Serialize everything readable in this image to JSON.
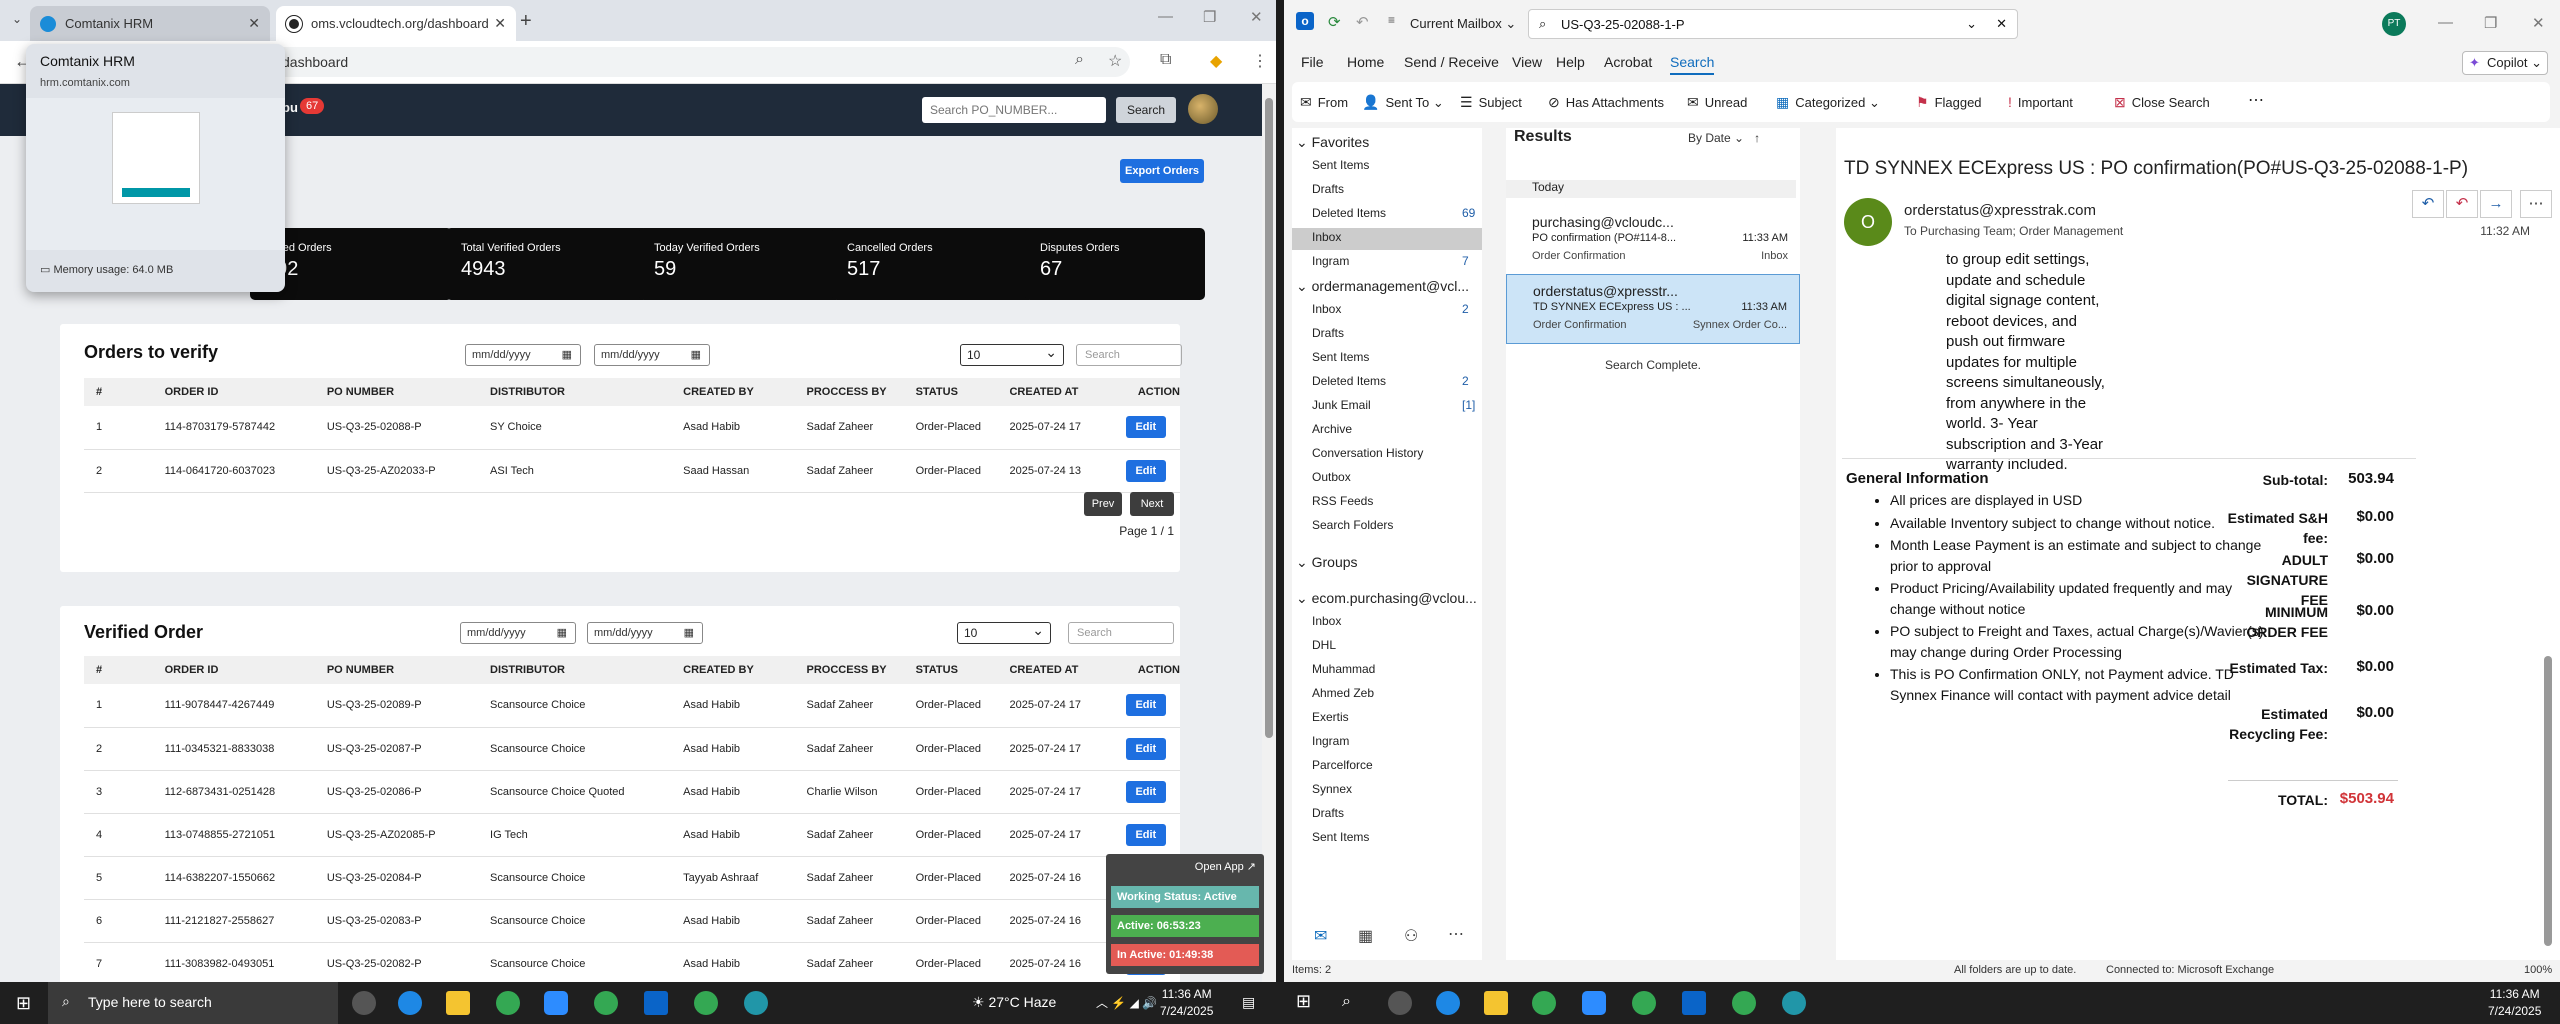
{
  "chrome": {
    "tabs": [
      {
        "title": "Comtanix HRM"
      },
      {
        "title": "oms.vcloudtech.org/dashboard"
      }
    ],
    "url_fragment": "dashboard",
    "hover_card": {
      "title": "Comtanix HRM",
      "host": "hrm.comtanix.com",
      "memory": "Memory usage: 64.0 MB"
    }
  },
  "app": {
    "nav": {
      "brand_fragment": "pu",
      "badge": "67",
      "search_placeholder": "Search PO_NUMBER...",
      "search_button": "Search"
    },
    "export_button": "Export Orders",
    "stats": [
      {
        "label": "pleted Orders",
        "value": "592"
      },
      {
        "label": "Total Verified Orders",
        "value": "4943"
      },
      {
        "label": "Today Verified Orders",
        "value": "59"
      },
      {
        "label": "Cancelled Orders",
        "value": "517"
      },
      {
        "label": "Disputes Orders",
        "value": "67"
      }
    ],
    "date_placeholder": "mm/dd/yyyy",
    "page_size": "10",
    "table_search_placeholder": "Search",
    "columns": [
      "#",
      "ORDER ID",
      "PO NUMBER",
      "DISTRIBUTOR",
      "CREATED BY",
      "PROCCESS BY",
      "STATUS",
      "CREATED AT",
      "ACTION"
    ],
    "orders_to_verify": {
      "title": "Orders to verify",
      "rows": [
        [
          "1",
          "114-8703179-5787442",
          "US-Q3-25-02088-P",
          "SY Choice",
          "Asad Habib",
          "Sadaf Zaheer",
          "Order-Placed",
          "2025-07-24 17"
        ],
        [
          "2",
          "114-0641720-6037023",
          "US-Q3-25-AZ02033-P",
          "ASI Tech",
          "Saad Hassan",
          "Sadaf Zaheer",
          "Order-Placed",
          "2025-07-24 13"
        ]
      ],
      "prev": "Prev",
      "next": "Next",
      "page_info": "Page 1 / 1"
    },
    "verified": {
      "title": "Verified Order",
      "rows": [
        [
          "1",
          "111-9078447-4267449",
          "US-Q3-25-02089-P",
          "Scansource Choice",
          "Asad Habib",
          "Sadaf Zaheer",
          "Order-Placed",
          "2025-07-24 17"
        ],
        [
          "2",
          "111-0345321-8833038",
          "US-Q3-25-02087-P",
          "Scansource Choice",
          "Asad Habib",
          "Sadaf Zaheer",
          "Order-Placed",
          "2025-07-24 17"
        ],
        [
          "3",
          "112-6873431-0251428",
          "US-Q3-25-02086-P",
          "Scansource Choice Quoted",
          "Asad Habib",
          "Charlie Wilson",
          "Order-Placed",
          "2025-07-24 17"
        ],
        [
          "4",
          "113-0748855-2721051",
          "US-Q3-25-AZ02085-P",
          "IG Tech",
          "Asad Habib",
          "Sadaf Zaheer",
          "Order-Placed",
          "2025-07-24 17"
        ],
        [
          "5",
          "114-6382207-1550662",
          "US-Q3-25-02084-P",
          "Scansource Choice",
          "Tayyab Ashraaf",
          "Sadaf Zaheer",
          "Order-Placed",
          "2025-07-24 16"
        ],
        [
          "6",
          "111-2121827-2558627",
          "US-Q3-25-02083-P",
          "Scansource Choice",
          "Asad Habib",
          "Sadaf Zaheer",
          "Order-Placed",
          "2025-07-24 16"
        ],
        [
          "7",
          "111-3083982-0493051",
          "US-Q3-25-02082-P",
          "Scansource Choice",
          "Asad Habib",
          "Sadaf Zaheer",
          "Order-Placed",
          "2025-07-24 16"
        ]
      ]
    },
    "edit_label": "Edit"
  },
  "timer": {
    "open_app": "Open App ↗",
    "working": "Working Status: Active",
    "active": "Active: 06:53:23",
    "inactive": "In Active: 01:49:38"
  },
  "outlook": {
    "mailbox": "Current Mailbox",
    "search_query": "US-Q3-25-02088-1-P",
    "avatar": "PT",
    "copilot": "Copilot",
    "menu": [
      "File",
      "Home",
      "Send / Receive",
      "View",
      "Help",
      "Acrobat",
      "Search"
    ],
    "ribbon": [
      "From",
      "Sent To",
      "Subject",
      "Has Attachments",
      "Unread",
      "Categorized",
      "Flagged",
      "Important",
      "Close Search"
    ],
    "folders": [
      {
        "label": "Favorites",
        "head": true
      },
      {
        "label": "Sent Items"
      },
      {
        "label": "Drafts"
      },
      {
        "label": "Deleted Items",
        "count": "69"
      },
      {
        "label": "Inbox"
      },
      {
        "label": "Ingram",
        "count": "7"
      },
      {
        "label": "ordermanagement@vcl...",
        "head": true
      },
      {
        "label": "Inbox",
        "count": "2"
      },
      {
        "label": "Drafts"
      },
      {
        "label": "Sent Items"
      },
      {
        "label": "Deleted Items",
        "count": "2"
      },
      {
        "label": "Junk Email",
        "count": "[1]"
      },
      {
        "label": "Archive"
      },
      {
        "label": "Conversation History"
      },
      {
        "label": "Outbox"
      },
      {
        "label": "RSS Feeds"
      },
      {
        "label": "Search Folders"
      },
      {
        "label": "Groups",
        "head": true
      },
      {
        "label": "ecom.purchasing@vclou...",
        "head": true
      },
      {
        "label": "Inbox"
      },
      {
        "label": "DHL"
      },
      {
        "label": "Muhammad"
      },
      {
        "label": "Ahmed Zeb"
      },
      {
        "label": "Exertis"
      },
      {
        "label": "Ingram"
      },
      {
        "label": "Parcelforce"
      },
      {
        "label": "Synnex"
      },
      {
        "label": "Drafts"
      },
      {
        "label": "Sent Items"
      }
    ],
    "results": {
      "title": "Results",
      "sort": "By Date",
      "today": "Today",
      "messages": [
        {
          "from": "purchasing@vcloudc...",
          "subject": "PO confirmation (PO#114-8...",
          "time": "11:33 AM",
          "snippet": "Order Confirmation",
          "folder": "Inbox"
        },
        {
          "from": "orderstatus@xpresstr...",
          "subject": "TD SYNNEX ECExpress US : ...",
          "time": "11:33 AM",
          "snippet": "Order Confirmation",
          "folder": "Synnex Order Co..."
        }
      ],
      "complete": "Search Complete."
    },
    "reading": {
      "subject": "TD SYNNEX ECExpress US : PO confirmation(PO#US-Q3-25-02088-1-P)",
      "avatar": "O",
      "from": "orderstatus@xpresstrak.com",
      "to": "To   Purchasing Team; Order Management",
      "time": "11:32 AM",
      "description": "to group edit settings, update and schedule digital signage content, reboot devices, and push out firmware updates for multiple screens simultaneously, from anywhere in the world. 3- Year subscription and 3-Year warranty included.",
      "gi_title": "General Information",
      "gi_items": [
        "All prices are displayed in USD",
        "Available Inventory subject to change without notice.",
        "Month Lease Payment is an estimate and subject to change prior to approval",
        "Product Pricing/Availability updated frequently and may change without notice",
        "PO subject to Freight and Taxes, actual Charge(s)/Wavier(s) may change during Order Processing",
        "This is PO Confirmation ONLY, not Payment advice. TD Synnex Finance will contact with payment advice detail"
      ],
      "totals": [
        {
          "label": "Sub-total:",
          "value": "503.94"
        },
        {
          "label": "Estimated S&H fee:",
          "value": "$0.00"
        },
        {
          "label": "ADULT SIGNATURE FEE",
          "value": "$0.00"
        },
        {
          "label": "MINIMUM ORDER FEE",
          "value": "$0.00"
        },
        {
          "label": "Estimated Tax:",
          "value": "$0.00"
        },
        {
          "label": "Estimated Recycling Fee:",
          "value": "$0.00"
        },
        {
          "label": "TOTAL:",
          "value": "$503.94"
        }
      ]
    },
    "status": {
      "items": "Items: 2",
      "uptodate": "All folders are up to date.",
      "connected": "Connected to: Microsoft Exchange",
      "zoom": "100%"
    }
  },
  "taskbar": {
    "search": "Type here to search",
    "weather": "27°C  Haze",
    "time_left": "11:36 AM",
    "date_left": "7/24/2025",
    "time_right": "11:36 AM",
    "date_right": "7/24/2025"
  },
  "colors": {
    "accent_blue": "#1e6fe0",
    "timer_working": "#67b7ad",
    "timer_active": "#4caf50",
    "timer_inactive": "#e35b55",
    "highlight": "#fff100",
    "total_red": "#d13438"
  }
}
